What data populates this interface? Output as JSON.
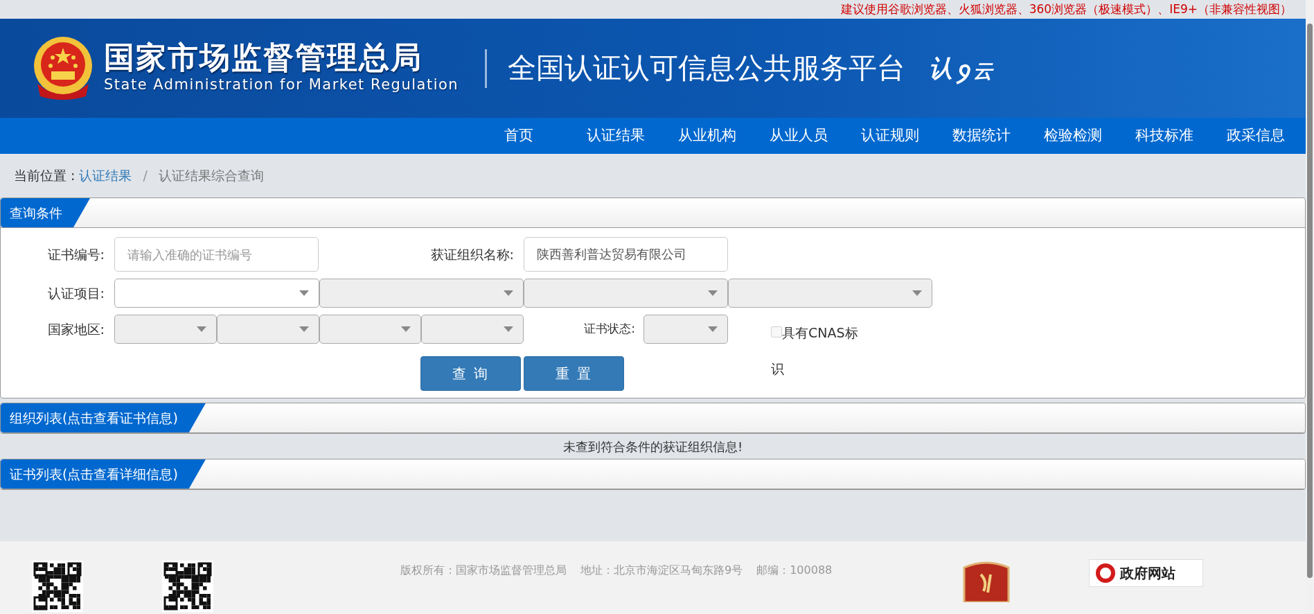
{
  "browser_notice": "建议使用谷歌浏览器、火狐浏览器、360浏览器（极速模式）、IE9+（非兼容性视图）",
  "header": {
    "agency_name": "国家市场监督管理总局",
    "agency_name_en": "State Administration for Market Regulation",
    "platform_name": "全国认证认可信息公共服务平台",
    "logo_chars": [
      "认",
      "云"
    ]
  },
  "nav": [
    {
      "label": "首页",
      "selected": false
    },
    {
      "label": "认证结果",
      "selected": false
    },
    {
      "label": "从业机构",
      "selected": false
    },
    {
      "label": "从业人员",
      "selected": false
    },
    {
      "label": "认证规则",
      "selected": false
    },
    {
      "label": "数据统计",
      "selected": false
    },
    {
      "label": "检验检测",
      "selected": false
    },
    {
      "label": "科技标准",
      "selected": false
    },
    {
      "label": "政采信息",
      "selected": false
    }
  ],
  "breadcrumb": {
    "label": "当前位置 :",
    "separator": "/",
    "items": [
      {
        "text": "认证结果",
        "link": true
      },
      {
        "text": "认证结果综合查询",
        "link": false
      }
    ]
  },
  "query_panel": {
    "title": "查询条件",
    "cert_number": {
      "label": "证书编号:",
      "placeholder": "请输入准确的证书编号"
    },
    "org_name": {
      "label": "获证组织名称:",
      "value": "陕西善利普达贸易有限公司"
    },
    "cert_project": {
      "label": "认证项目:",
      "selects": [
        {
          "disabled": false
        },
        {
          "disabled": true
        },
        {
          "disabled": true
        },
        {
          "disabled": true
        }
      ]
    },
    "region": {
      "label": "国家地区:",
      "selects": [
        {
          "disabled": true
        },
        {
          "disabled": true
        },
        {
          "disabled": true
        },
        {
          "disabled": true
        }
      ]
    },
    "cert_status": {
      "label": "证书状态:",
      "disabled": true
    },
    "cnas": {
      "label": "具有CNAS标识",
      "checked": false,
      "disabled": true
    },
    "buttons": [
      "查 询",
      "重 置"
    ]
  },
  "org_panel": {
    "title": "组织列表(点击查看证书信息)",
    "empty_message": "未查到符合条件的获证组织信息!"
  },
  "cert_panel": {
    "title": "证书列表(点击查看详细信息)"
  },
  "footer": {
    "copyright": "版权所有：国家市场监督管理总局",
    "address": "地址：北京市海淀区马甸东路9号",
    "postcode": "邮编：100088",
    "gov_badge": "政府网站"
  }
}
